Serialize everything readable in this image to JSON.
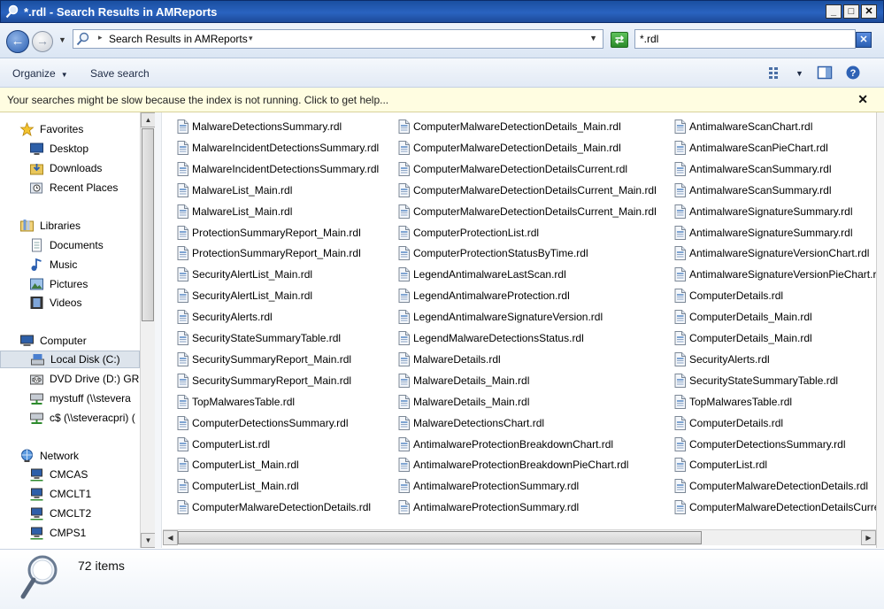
{
  "window": {
    "title": "*.rdl - Search Results in AMReports",
    "minimize_label": "_",
    "maximize_label": "□",
    "close_label": "✕"
  },
  "address": {
    "back_label": "←",
    "forward_label": "→",
    "breadcrumb": "Search Results in AMReports",
    "refresh_label": "⇄",
    "search_value": "*.rdl",
    "search_clear_label": "✕"
  },
  "toolbar": {
    "organize_label": "Organize",
    "save_search_label": "Save search"
  },
  "infobar": {
    "text": "Your searches might be slow because the index is not running.  Click to get help...",
    "close_label": "✕"
  },
  "navpane": {
    "favorites": {
      "label": "Favorites",
      "items": [
        "Desktop",
        "Downloads",
        "Recent Places"
      ]
    },
    "libraries": {
      "label": "Libraries",
      "items": [
        "Documents",
        "Music",
        "Pictures",
        "Videos"
      ]
    },
    "computer": {
      "label": "Computer",
      "items": [
        "Local Disk (C:)",
        "DVD Drive (D:) GRM",
        "mystuff (\\\\stevera",
        "c$ (\\\\steveracpri) ("
      ]
    },
    "network": {
      "label": "Network",
      "items": [
        "CMCAS",
        "CMCLT1",
        "CMCLT2",
        "CMPS1"
      ]
    }
  },
  "files": {
    "col1": [
      "MalwareDetectionsSummary.rdl",
      "MalwareIncidentDetectionsSummary.rdl",
      "MalwareIncidentDetectionsSummary.rdl",
      "MalwareList_Main.rdl",
      "MalwareList_Main.rdl",
      "ProtectionSummaryReport_Main.rdl",
      "ProtectionSummaryReport_Main.rdl",
      "SecurityAlertList_Main.rdl",
      "SecurityAlertList_Main.rdl",
      "SecurityAlerts.rdl",
      "SecurityStateSummaryTable.rdl",
      "SecuritySummaryReport_Main.rdl",
      "SecuritySummaryReport_Main.rdl",
      "TopMalwaresTable.rdl",
      "ComputerDetectionsSummary.rdl",
      "ComputerList.rdl",
      "ComputerList_Main.rdl",
      "ComputerList_Main.rdl",
      "ComputerMalwareDetectionDetails.rdl"
    ],
    "col2": [
      "ComputerMalwareDetectionDetails_Main.rdl",
      "ComputerMalwareDetectionDetails_Main.rdl",
      "ComputerMalwareDetectionDetailsCurrent.rdl",
      "ComputerMalwareDetectionDetailsCurrent_Main.rdl",
      "ComputerMalwareDetectionDetailsCurrent_Main.rdl",
      "ComputerProtectionList.rdl",
      "ComputerProtectionStatusByTime.rdl",
      "LegendAntimalwareLastScan.rdl",
      "LegendAntimalwareProtection.rdl",
      "LegendAntimalwareSignatureVersion.rdl",
      "LegendMalwareDetectionsStatus.rdl",
      "MalwareDetails.rdl",
      "MalwareDetails_Main.rdl",
      "MalwareDetails_Main.rdl",
      "MalwareDetectionsChart.rdl",
      "AntimalwareProtectionBreakdownChart.rdl",
      "AntimalwareProtectionBreakdownPieChart.rdl",
      "AntimalwareProtectionSummary.rdl",
      "AntimalwareProtectionSummary.rdl"
    ],
    "col3": [
      "AntimalwareScanChart.rdl",
      "AntimalwareScanPieChart.rdl",
      "AntimalwareScanSummary.rdl",
      "AntimalwareScanSummary.rdl",
      "AntimalwareSignatureSummary.rdl",
      "AntimalwareSignatureSummary.rdl",
      "AntimalwareSignatureVersionChart.rdl",
      "AntimalwareSignatureVersionPieChart.rdl",
      "ComputerDetails.rdl",
      "ComputerDetails_Main.rdl",
      "ComputerDetails_Main.rdl",
      "SecurityAlerts.rdl",
      "SecurityStateSummaryTable.rdl",
      "TopMalwaresTable.rdl",
      "ComputerDetails.rdl",
      "ComputerDetectionsSummary.rdl",
      "ComputerList.rdl",
      "ComputerMalwareDetectionDetails.rdl",
      "ComputerMalwareDetectionDetailsCurre"
    ]
  },
  "details": {
    "item_count": "72 items"
  },
  "colors": {
    "titlebar": "#2a63c0",
    "infobar_bg": "#fffde1",
    "selection": "#dde4ec"
  }
}
